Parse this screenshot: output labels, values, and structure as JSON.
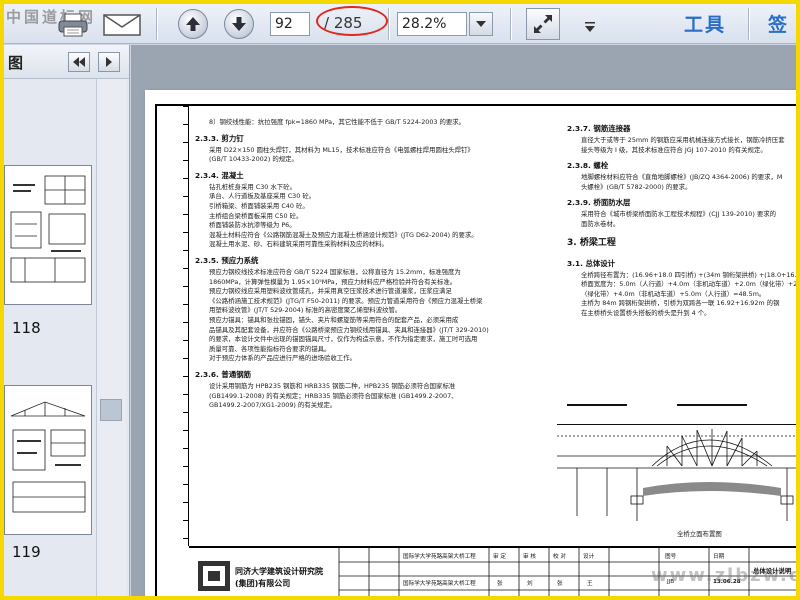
{
  "watermark_top": "中国道标网",
  "watermark_bottom": "www.zlbzw.com",
  "toolbar": {
    "current_page": "92",
    "page_total": "/ 285",
    "zoom": "28.2%",
    "tools_label": "工具",
    "share_label": "签"
  },
  "panel": {
    "title": "图",
    "thumbnails": [
      {
        "label": "118"
      },
      {
        "label": "119"
      }
    ]
  },
  "document": {
    "left_column": [
      {
        "type": "text",
        "text": "8）钢绞线性能：抗拉强度 fpk=1860 MPa，其它性能不低于 GB/T 5224-2003 的要求。"
      },
      {
        "type": "heading",
        "text": "2.3.3. 剪力钉"
      },
      {
        "type": "text",
        "text": "采用 D22×150 圆柱头焊钉，其材料为 ML15，技术标准应符合《电弧螺柱焊用圆柱头焊钉》"
      },
      {
        "type": "text",
        "text": "(GB/T 10433-2002) 的规定。"
      },
      {
        "type": "heading",
        "text": "2.3.4. 混凝土"
      },
      {
        "type": "text",
        "text": "钻孔桩桩身采用 C30 水下砼。"
      },
      {
        "type": "text",
        "text": "承台、人行道板及基座采用 C30 砼。"
      },
      {
        "type": "text",
        "text": "引桥箱梁、桥面铺装采用 C40 砼。"
      },
      {
        "type": "text",
        "text": "主桥组合梁桥面板采用 C50 砼。"
      },
      {
        "type": "text",
        "text": "桥面铺装防水抗渗等级为 P6。"
      },
      {
        "type": "text",
        "text": "混凝土材料应符合《公路钢筋混凝土及预应力混凝土桥涵设计规范》(JTG D62-2004) 的要求。"
      },
      {
        "type": "text",
        "text": "混凝土用水泥、砂、石料建筑采用可靠性采购材料及应的材料。"
      },
      {
        "type": "heading",
        "text": "2.3.5. 预应力系统"
      },
      {
        "type": "text",
        "text": "预应力钢绞线技术标准应符合 GB/T 5224 国家标准，公称直径为 15.2mm，标准强度为"
      },
      {
        "type": "text",
        "text": "1860MPa，计算弹性模量为 1.95×10⁵MPa，预应力材料应严格检验并符合有关标准。"
      },
      {
        "type": "text",
        "text": "预应力钢绞线应采用塑料波纹管成孔，并采用真空压浆技术进行管道灌浆，压浆应满足"
      },
      {
        "type": "text",
        "text": "《公路桥涵施工技术规范》(JTG/T F50-2011) 的要求。预应力管道采用符合《预应力混凝土桥梁"
      },
      {
        "type": "text",
        "text": "用塑料波纹管》(JT/T 529-2004) 标准的高密度聚乙烯塑料波纹管。"
      },
      {
        "type": "text",
        "text": "预应力锚具：锚具和张拉锚固，锚头、夹片和螺旋筋等采用符合的配套产品，必须采用成"
      },
      {
        "type": "text",
        "text": "品锚具及其配套设备，并应符合《公路桥梁预应力钢绞线用锚具、夹具和连接器》(JT/T 329-2010)"
      },
      {
        "type": "text",
        "text": "的要求，本设计文件中出现的锚固锚具尺寸，仅作为构造示意，不作为指定要求，施工时可选用"
      },
      {
        "type": "text",
        "text": "质量可靠、各项性能指标符合要求的锚具。"
      },
      {
        "type": "text",
        "text": "对于预应力体系的产品应进行严格的进场验收工作。"
      },
      {
        "type": "heading",
        "text": "2.3.6. 普通钢筋"
      },
      {
        "type": "text",
        "text": "设计采用钢筋为 HPB235 钢筋和 HRB335 钢筋二种，HPB235 钢筋必须符合国家标准"
      },
      {
        "type": "text",
        "text": "(GB1499.1-2008) 的有关规定；HRB335 钢筋必须符合国家标准 (GB1499.2-2007、"
      },
      {
        "type": "text",
        "text": "GB1499.2-2007/XG1-2009) 的有关规定。"
      }
    ],
    "right_column": [
      {
        "type": "heading",
        "text": "2.3.7. 钢筋连接器"
      },
      {
        "type": "text",
        "text": "直径大于或等于 25mm 的钢筋应采用机械连接方式接长，钢筋冷挤压套"
      },
      {
        "type": "text",
        "text": "接头等级为 I 级，其技术标准应符合 JGJ 107-2010 的有关规定。"
      },
      {
        "type": "heading",
        "text": "2.3.8. 螺栓"
      },
      {
        "type": "text",
        "text": "地脚螺栓材料应符合《直角地脚螺栓》(JB/ZQ 4364-2006) 的要求，M"
      },
      {
        "type": "text",
        "text": "头螺栓》(GB/T 5782-2000) 的要求。"
      },
      {
        "type": "heading",
        "text": "2.3.9. 桥面防水层"
      },
      {
        "type": "text",
        "text": "采用符合《城市桥梁桥面防水工程技术规程》(CJJ 139-2010) 要求的"
      },
      {
        "type": "text",
        "text": "面防水卷材。"
      },
      {
        "type": "heading2",
        "text": "3.  桥梁工程"
      },
      {
        "type": "heading",
        "text": "3.1. 总体设计"
      },
      {
        "type": "text",
        "text": "全桥跨径布置为：(16.96+18.0 四引桥) +(34m 钢桁架拱桥) +(18.0+16.9"
      },
      {
        "type": "text",
        "text": "桥面宽度为：5.0m（人行道）+4.0m（非机动车道）+2.0m（绿化带）+21"
      },
      {
        "type": "text",
        "text": "（绿化带）+4.0m（非机动车道）+5.0m（人行道）=48.5m。"
      },
      {
        "type": "text",
        "text": "主桥为 84m 跨钢桁架拱桥，引桥为双跨各一联 16.92+16.92m 的钢"
      },
      {
        "type": "text",
        "text": "在主桥桥头设置桥头搭板的桥头是升到 4 个。"
      }
    ],
    "elevation_caption": "全桥立面布置图",
    "title_block": {
      "institute_line1": "同济大学建筑设计研究院",
      "institute_line2": "(集团)有限公司",
      "project": "国际学大学苑路高架大桥工程",
      "labels": [
        "审 定",
        "审 核",
        "校 对",
        "设计",
        "图号",
        "日期"
      ],
      "names": [
        "张",
        "刘",
        "张",
        "王",
        "JJB",
        "13.06.28"
      ],
      "sheet_title": "总体设计说明"
    }
  }
}
